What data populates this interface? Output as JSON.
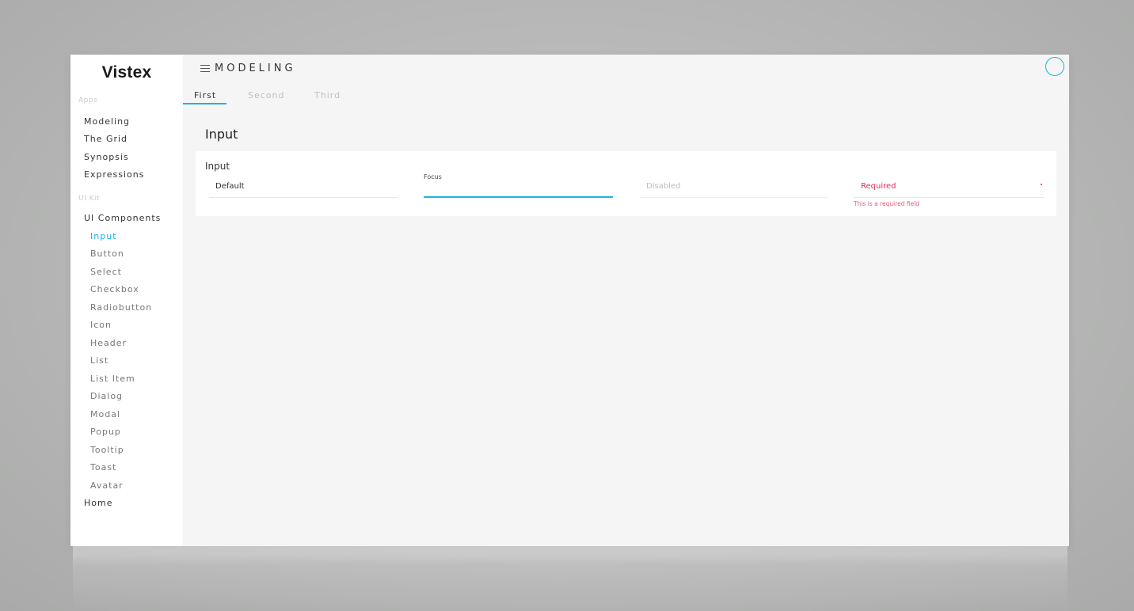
{
  "sidebar": {
    "logo": "Vistex",
    "apps_label": "Apps",
    "apps": [
      "Modeling",
      "The Grid",
      "Synopsis",
      "Expressions"
    ],
    "uikit_label": "UI Kit",
    "ui_components_label": "UI Components",
    "components": [
      "Input",
      "Button",
      "Select",
      "Checkbox",
      "Radiobutton",
      "Icon",
      "Header",
      "List",
      "List Item",
      "Dialog",
      "Modal",
      "Popup",
      "Tooltip",
      "Toast",
      "Avatar"
    ],
    "active_component": "Input",
    "home_label": "Home"
  },
  "header": {
    "title": "MODELING"
  },
  "tabs": [
    {
      "label": "First",
      "active": true
    },
    {
      "label": "Second",
      "active": false
    },
    {
      "label": "Third",
      "active": false
    }
  ],
  "main": {
    "page_title": "Input",
    "card_title": "Input",
    "fields": {
      "default_value": "Default",
      "focus_label": "Focus",
      "disabled_value": "Disabled",
      "required_value": "Required",
      "required_error": "This is a required field"
    }
  },
  "colors": {
    "accent": "#1ab3e6",
    "error": "#d6325b"
  },
  "icons": {
    "menu": "hamburger-menu-icon",
    "avatar": "avatar-circle-icon"
  }
}
